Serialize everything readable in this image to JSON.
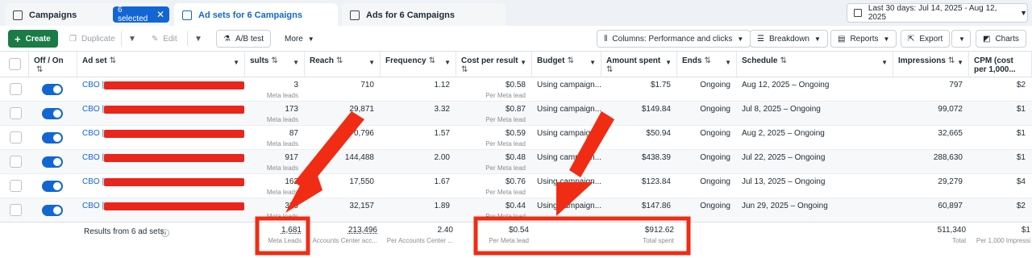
{
  "tabs": {
    "campaigns": "Campaigns",
    "selected": "6 selected",
    "adsets": "Ad sets for 6 Campaigns",
    "ads": "Ads for 6 Campaigns"
  },
  "date_range": "Last 30 days: Jul 14, 2025 - Aug 12, 2025",
  "toolbar": {
    "create": "Create",
    "duplicate": "Duplicate",
    "edit": "Edit",
    "ab_test": "A/B test",
    "more": "More",
    "columns": "Columns: Performance and clicks",
    "breakdown": "Breakdown",
    "reports": "Reports",
    "export": "Export",
    "charts": "Charts"
  },
  "columns": {
    "onoff": "Off / On",
    "adset": "Ad set",
    "results": "sults",
    "reach": "Reach",
    "frequency": "Frequency",
    "cost": "Cost per result",
    "budget": "Budget",
    "spent": "Amount spent",
    "ends": "Ends",
    "schedule": "Schedule",
    "impressions": "Impressions",
    "cpm": "CPM (cost per 1,000..."
  },
  "rows": [
    {
      "name": "CBO |",
      "results": "3",
      "results_sub": "Meta leads",
      "reach": "710",
      "frequency": "1.12",
      "cost": "$0.58",
      "cost_sub": "Per Meta lead",
      "budget": "Using campaign...",
      "spent": "$1.75",
      "ends": "Ongoing",
      "schedule": "Aug 12, 2025 – Ongoing",
      "impressions": "797",
      "cpm": "$2"
    },
    {
      "name": "CBO |",
      "results": "173",
      "results_sub": "Meta leads",
      "reach": "29,871",
      "frequency": "3.32",
      "cost": "$0.87",
      "cost_sub": "Per Meta lead",
      "budget": "Using campaign...",
      "spent": "$149.84",
      "ends": "Ongoing",
      "schedule": "Jul 8, 2025 – Ongoing",
      "impressions": "99,072",
      "cpm": "$1"
    },
    {
      "name": "CBO |",
      "results": "87",
      "results_sub": "Meta leads",
      "reach": "0,796",
      "frequency": "1.57",
      "cost": "$0.59",
      "cost_sub": "Per Meta lead",
      "budget": "Using campaign...",
      "spent": "$50.94",
      "ends": "Ongoing",
      "schedule": "Aug 2, 2025 – Ongoing",
      "impressions": "32,665",
      "cpm": "$1"
    },
    {
      "name": "CBO |",
      "results": "917",
      "results_sub": "Meta leads",
      "reach": "144,488",
      "frequency": "2.00",
      "cost": "$0.48",
      "cost_sub": "Per Meta lead",
      "budget": "Using campaign...",
      "spent": "$438.39",
      "ends": "Ongoing",
      "schedule": "Jul 22, 2025 – Ongoing",
      "impressions": "288,630",
      "cpm": "$1"
    },
    {
      "name": "CBO |",
      "results": "162",
      "results_sub": "Meta leads",
      "reach": "17,550",
      "frequency": "1.67",
      "cost": "$0.76",
      "cost_sub": "Per Meta lead",
      "budget": "Using campaign...",
      "spent": "$123.84",
      "ends": "Ongoing",
      "schedule": "Jul 13, 2025 – Ongoing",
      "impressions": "29,279",
      "cpm": "$4"
    },
    {
      "name": "CBO |",
      "results": "339",
      "results_sub": "Meta leads",
      "reach": "32,157",
      "frequency": "1.89",
      "cost": "$0.44",
      "cost_sub": "Per Meta lead",
      "budget": "Using campaign...",
      "spent": "$147.86",
      "ends": "Ongoing",
      "schedule": "Jun 29, 2025 – Ongoing",
      "impressions": "60,897",
      "cpm": "$2"
    }
  ],
  "totals": {
    "label": "Results from 6 ad sets",
    "results": "1,681",
    "results_sub": "Meta Leads",
    "reach": "213,496",
    "reach_sub": "Accounts Center acc...",
    "frequency": "2.40",
    "frequency_sub": "Per Accounts Center ...",
    "cost": "$0.54",
    "cost_sub": "Per Meta lead",
    "spent": "$912.62",
    "spent_sub": "Total spent",
    "impressions": "511,340",
    "impressions_sub": "Total",
    "cpm": "$1",
    "cpm_sub": "Per 1,000 Impressi"
  },
  "accent_color": "#1266d4",
  "annotation_color": "#f02c14"
}
